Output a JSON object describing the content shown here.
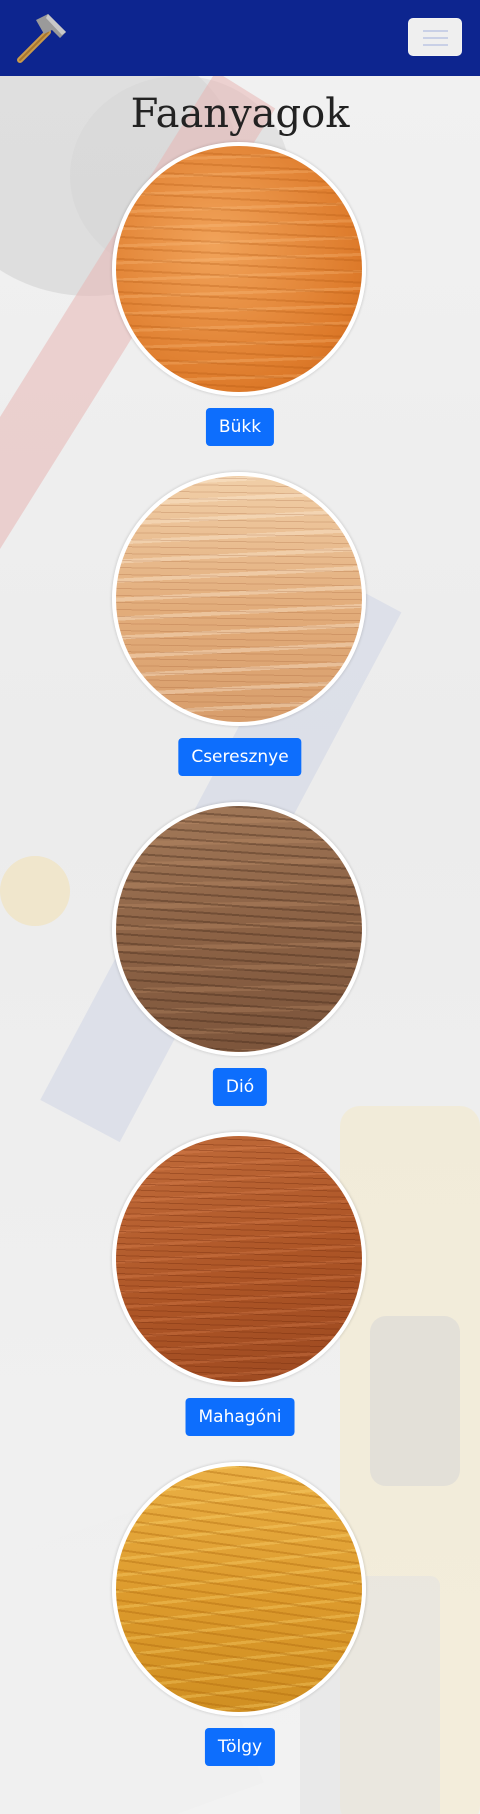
{
  "navbar": {
    "logo_icon": "hammer-icon",
    "toggler_icon": "menu-icon",
    "background": "#0d258f"
  },
  "page": {
    "title": "Faanyagok"
  },
  "woods": [
    {
      "label": "Bükk",
      "texture": "beech"
    },
    {
      "label": "Cseresznye",
      "texture": "cherry"
    },
    {
      "label": "Dió",
      "texture": "walnut"
    },
    {
      "label": "Mahagóni",
      "texture": "mahogany"
    },
    {
      "label": "Tölgy",
      "texture": "oak"
    }
  ],
  "colors": {
    "button": "#0d6efd",
    "button_text": "#ffffff"
  }
}
